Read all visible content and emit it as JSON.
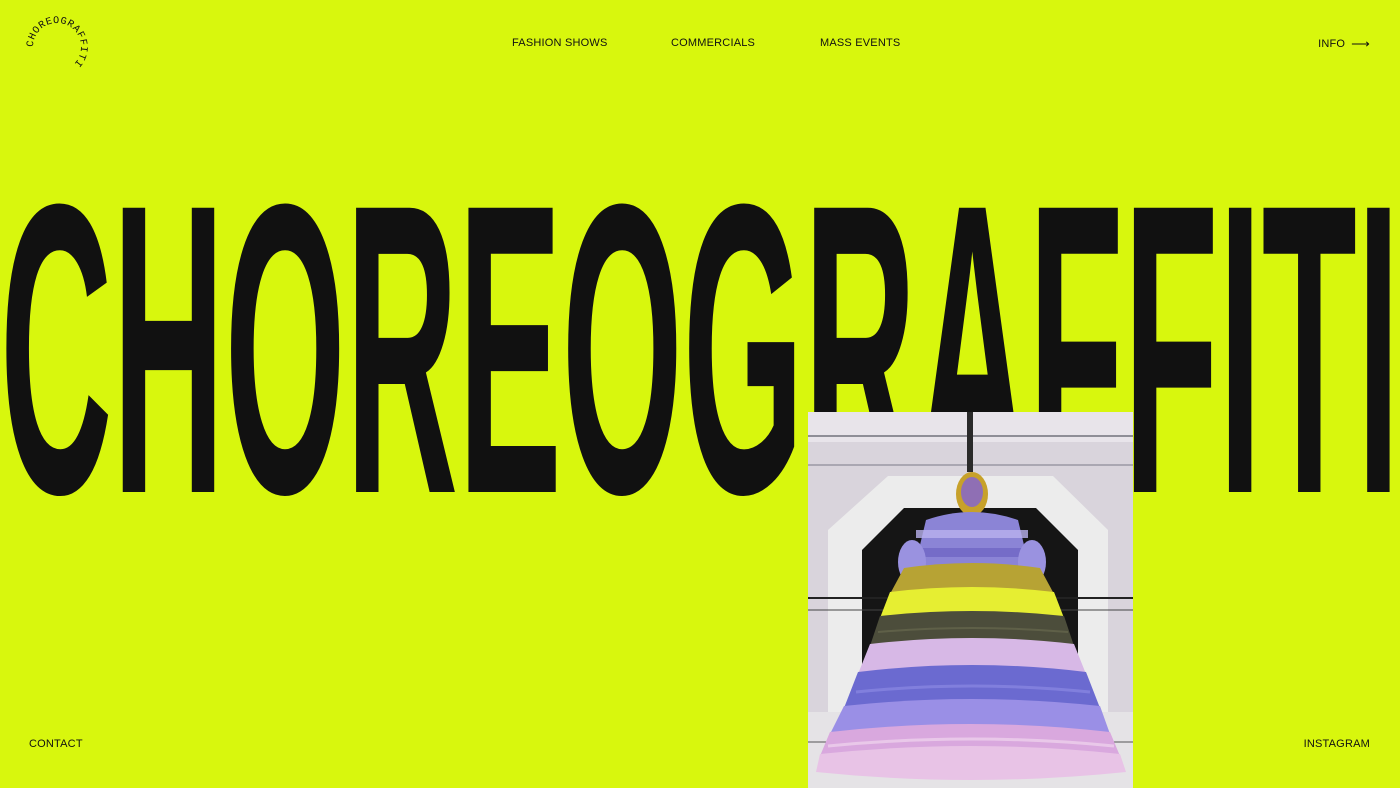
{
  "brand": {
    "logo_text": "CHOREOGRAFFITI",
    "hero_title": "CHOREOGRAFFITI"
  },
  "nav": {
    "fashion_shows": "FASHION SHOWS",
    "commercials": "COMMERCIALS",
    "mass_events": "MASS EVENTS",
    "info": "INFO",
    "info_icon": "arrow-right-icon"
  },
  "footer": {
    "contact": "CONTACT",
    "instagram": "INSTAGRAM"
  },
  "colors": {
    "background": "#d8f70d",
    "text": "#111111"
  }
}
